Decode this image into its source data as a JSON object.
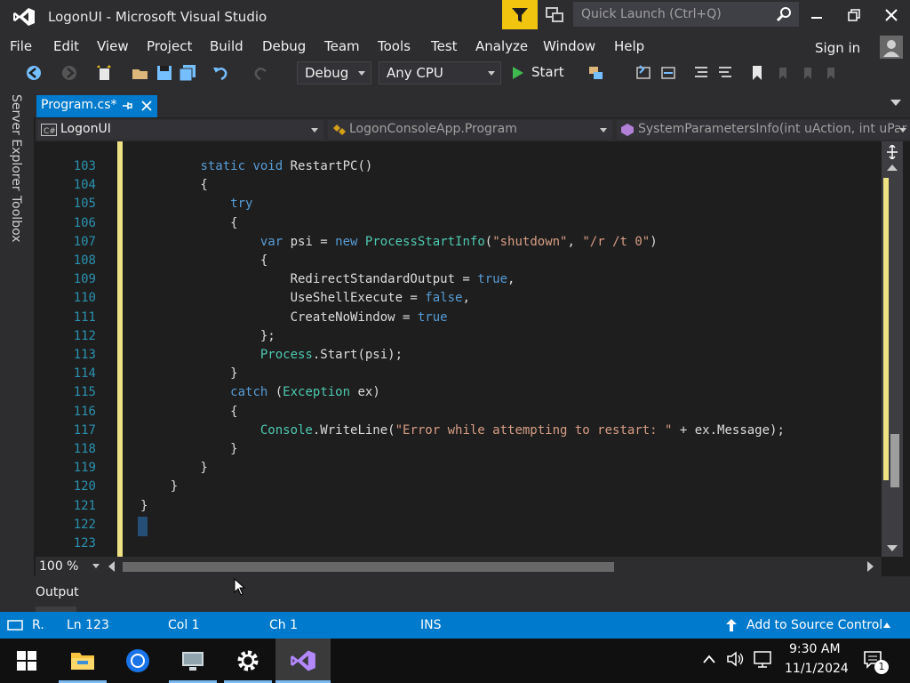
{
  "window": {
    "title": "LogonUI - Microsoft Visual Studio",
    "quick_launch_placeholder": "Quick Launch (Ctrl+Q)"
  },
  "menu": {
    "items": [
      "File",
      "Edit",
      "View",
      "Project",
      "Build",
      "Debug",
      "Team",
      "Tools",
      "Test",
      "Analyze",
      "Window",
      "Help"
    ],
    "sign_in": "Sign in"
  },
  "toolbar": {
    "configuration": "Debug",
    "platform": "Any CPU",
    "start_label": "Start"
  },
  "side_tabs": {
    "server_explorer": "Server Explorer",
    "toolbox": "Toolbox"
  },
  "document": {
    "tab_label": "Program.cs*",
    "nav_project": "LogonUI",
    "nav_class": "LogonConsoleApp.Program",
    "nav_member": "SystemParametersInfo(int uAction, int uPar"
  },
  "editor": {
    "line_numbers": [
      "103",
      "104",
      "105",
      "106",
      "107",
      "108",
      "109",
      "110",
      "111",
      "112",
      "113",
      "114",
      "115",
      "116",
      "117",
      "118",
      "119",
      "120",
      "121",
      "122",
      "123"
    ],
    "zoom": "100 %"
  },
  "output": {
    "label": "Output"
  },
  "status": {
    "ready": "R.",
    "line": "Ln 123",
    "col": "Col 1",
    "ch": "Ch 1",
    "mode": "INS",
    "source_control": "Add to Source Control"
  },
  "taskbar": {
    "time": "9:30 AM",
    "date": "11/1/2024",
    "notification_count": "1"
  },
  "colors": {
    "accent": "#007acc",
    "chrome": "#2d2d30",
    "editor_bg": "#1e1e1e",
    "keyword": "#569cd6",
    "type": "#4ec9b0",
    "string": "#d69d85",
    "change_marker": "#efe283"
  }
}
